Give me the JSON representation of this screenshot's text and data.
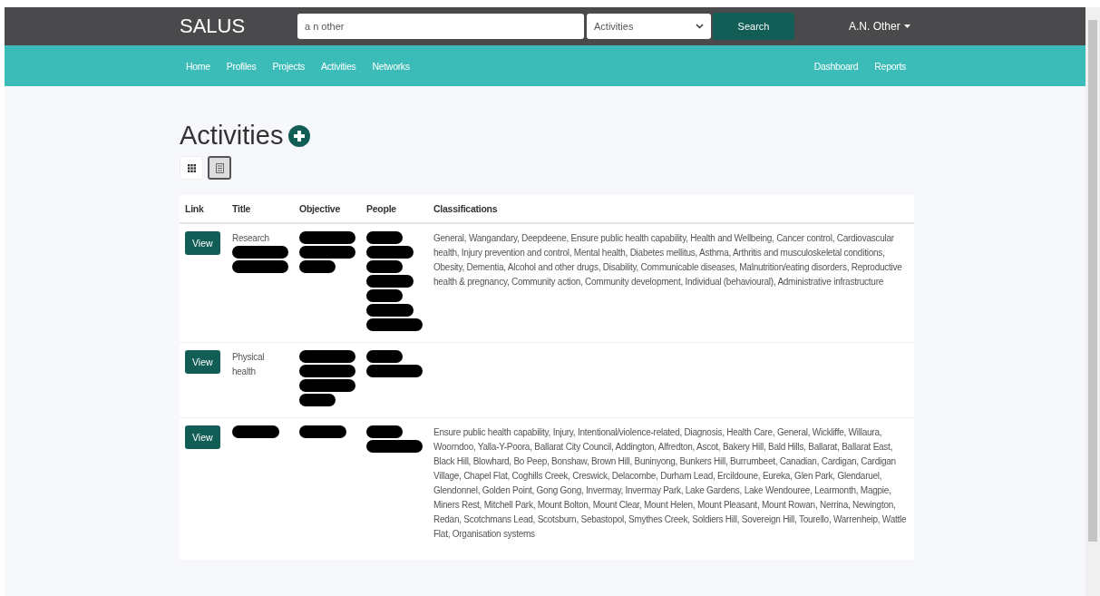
{
  "brand": {
    "logo": "SALUS"
  },
  "search": {
    "value": "a n other",
    "category": "Activities",
    "button": "Search"
  },
  "user": {
    "name": "A.N. Other"
  },
  "nav": {
    "left": [
      {
        "label": "Home"
      },
      {
        "label": "Profiles"
      },
      {
        "label": "Projects"
      },
      {
        "label": "Activities"
      },
      {
        "label": "Networks"
      }
    ],
    "right": [
      {
        "label": "Dashboard"
      },
      {
        "label": "Reports"
      }
    ]
  },
  "page": {
    "title": "Activities"
  },
  "view_toggle": [
    {
      "kind": "grid",
      "selected": false
    },
    {
      "kind": "list",
      "selected": true
    }
  ],
  "table": {
    "columns": [
      "Link",
      "Title",
      "Objective",
      "People",
      "Classifications"
    ],
    "rows": [
      {
        "link": "View",
        "title": {
          "text": "Research",
          "redacted": true
        },
        "objective": {
          "redacted": true
        },
        "people": {
          "redacted": true
        },
        "classifications": "General, Wangandary, Deepdeene, Ensure public health capability, Health and Wellbeing, Cancer control, Cardiovascular health, Injury prevention and control, Mental health, Diabetes mellitus, Asthma, Arthritis and musculoskeletal conditions, Obesity, Dementia, Alcohol and other drugs, Disability, Communicable diseases, Malnutrition/eating disorders, Reproductive health & pregnancy, Community action, Community development, Individual (behavioural), Administrative infrastructure"
      },
      {
        "link": "View",
        "title": {
          "text": "Physical health"
        },
        "objective": {
          "redacted": true
        },
        "people": {
          "redacted": true
        }
      },
      {
        "link": "View",
        "title": {
          "redacted": true
        },
        "objective": {
          "redacted": true
        },
        "people": {
          "redacted": true
        },
        "classifications": "Ensure public health capability, Injury, Intentional/violence-related, Diagnosis, Health Care, General, Wickliffe, Willaura, Woorndoo, Yalla-Y-Poora, Ballarat City Council, Addington, Alfredton, Ascot, Bakery Hill, Bald Hills, Ballarat, Ballarat East, Black Hill, Blowhard, Bo Peep, Bonshaw, Brown Hill, Buninyong, Bunkers Hill, Burrumbeet, Canadian, Cardigan, Cardigan Village, Chapel Flat, Coghills Creek, Creswick, Delacombe, Durham Lead, Ercildoune, Eureka, Glen Park, Glendaruel, Glendonnel, Golden Point, Gong Gong, Invermay, Invermay Park, Lake Gardens, Lake Wendouree, Learmonth, Magpie, Miners Rest, Mitchell Park, Mount Bolton, Mount Clear, Mount Helen, Mount Pleasant, Mount Rowan, Nerrina, Newington, Redan, Scotchmans Lead, Scotsburn, Sebastopol, Smythes Creek, Soldiers Hill, Sovereign Hill, Tourello, Warrenheip, Wattle Flat, Organisation systems"
      }
    ]
  }
}
